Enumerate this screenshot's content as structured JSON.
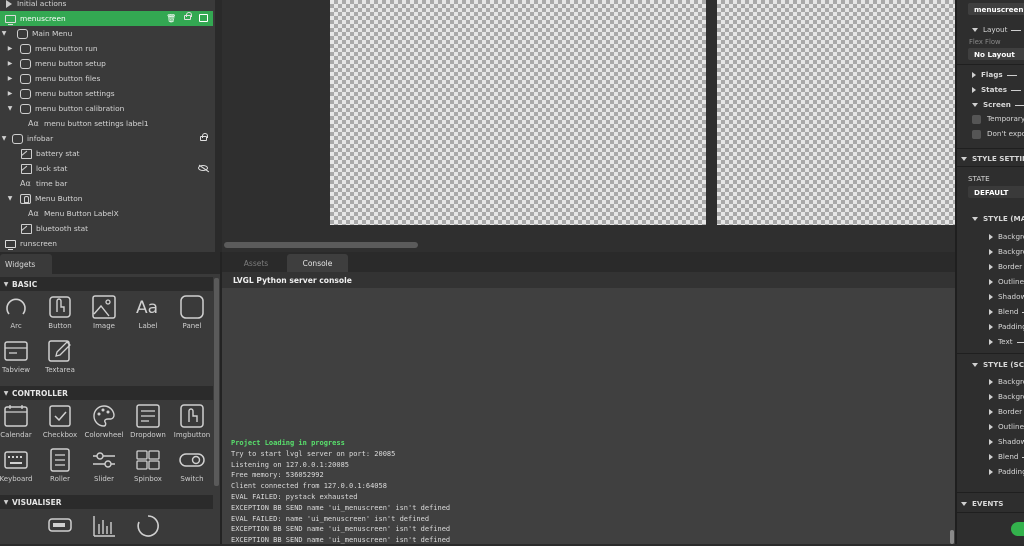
{
  "hierarchy": {
    "items": [
      {
        "label": "Initial actions"
      },
      {
        "label": "menuscreen"
      },
      {
        "label": "Main Menu"
      },
      {
        "label": "menu button run"
      },
      {
        "label": "menu button setup"
      },
      {
        "label": "menu button files"
      },
      {
        "label": "menu button settings"
      },
      {
        "label": "menu button calibration"
      },
      {
        "label": "menu button settings label1"
      },
      {
        "label": "infobar"
      },
      {
        "label": "battery stat"
      },
      {
        "label": "lock stat"
      },
      {
        "label": "time bar"
      },
      {
        "label": "Menu Button"
      },
      {
        "label": "Menu Button LabelX"
      },
      {
        "label": "bluetooth stat"
      },
      {
        "label": "runscreen"
      }
    ]
  },
  "widgets": {
    "tab_label": "Widgets",
    "sections": [
      {
        "title": "BASIC",
        "items": [
          "Arc",
          "Button",
          "Image",
          "Label",
          "Panel",
          "Tabview",
          "Textarea"
        ]
      },
      {
        "title": "CONTROLLER",
        "items": [
          "Calendar",
          "Checkbox",
          "Colorwheel",
          "Dropdown",
          "Imgbutton",
          "Keyboard",
          "Roller",
          "Slider",
          "Spinbox",
          "Switch"
        ]
      },
      {
        "title": "VISUALISER",
        "items": []
      }
    ]
  },
  "console": {
    "tabs": [
      "Assets",
      "Console"
    ],
    "active_tab": "Console",
    "title": "LVGL Python server console",
    "lines": [
      "Project Loading in progress",
      "Try to start lvgl server on port: 20085",
      "Listening on 127.0.0.1:20085",
      "Free memory: 536052992",
      "Client connected from 127.0.0.1:64058",
      "EVAL FAILED: pystack exhausted",
      "EXCEPTION BB SEND name 'ui_menuscreen' isn't defined",
      "EVAL FAILED: name 'ui_menuscreen' isn't defined",
      "EXCEPTION BB SEND name 'ui_menuscreen' isn't defined",
      "EXCEPTION BB SEND name 'ui_menuscreen' isn't defined"
    ]
  },
  "properties": {
    "name_value": "menuscreen",
    "layout_label": "Layout",
    "flex_flow_label": "Flex Flow",
    "flex_flow_value": "No Layout",
    "flags_label": "Flags",
    "states_label": "States",
    "screen_label": "Screen",
    "temporary_label": "Temporary",
    "dont_export_label": "Don't export",
    "style_settings_label": "STYLE SETTINGS",
    "state_label": "STATE",
    "state_value": "DEFAULT",
    "style_main_label": "STYLE (MAIN)",
    "style_main_items": [
      "Background",
      "Background",
      "Border",
      "Outline",
      "Shadow",
      "Blend",
      "Padding",
      "Text"
    ],
    "style_scroll_label": "STYLE (SCROLLBAR)",
    "style_scroll_items": [
      "Background",
      "Background",
      "Border",
      "Outline",
      "Shadow",
      "Blend",
      "Padding"
    ],
    "events_label": "EVENTS"
  },
  "colors": {
    "selection": "#33a852",
    "log_highlight": "#58e06c"
  }
}
